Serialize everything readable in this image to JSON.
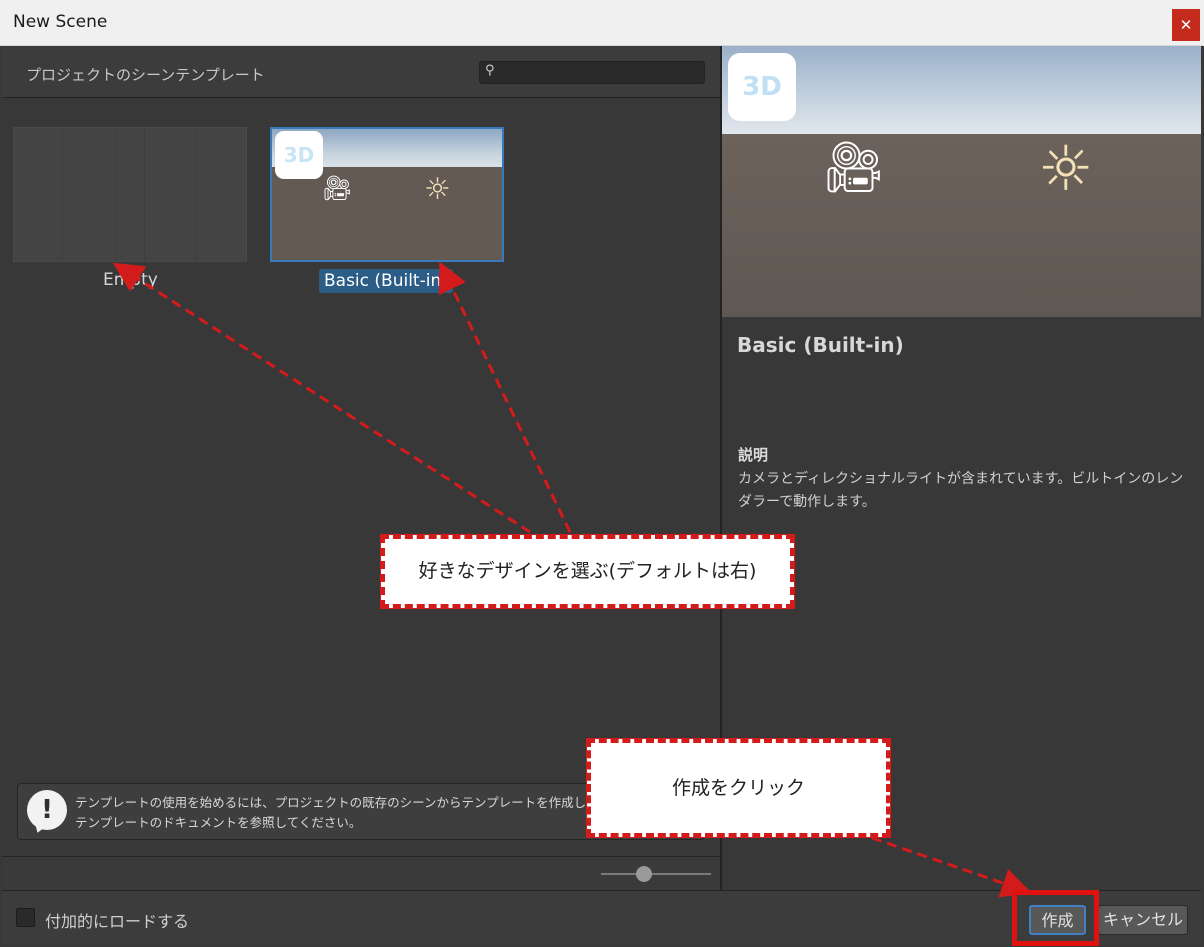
{
  "window": {
    "title": "New Scene",
    "close_glyph": "✕"
  },
  "left_panel": {
    "heading": "プロジェクトのシーンテンプレート",
    "search": {
      "icon": "search-icon",
      "value": "",
      "placeholder": ""
    },
    "templates": [
      {
        "label": "Empty",
        "selected": false
      },
      {
        "label": "Basic (Built-in)",
        "selected": true,
        "badge": "3D"
      }
    ],
    "help": {
      "icon": "exclamation-icon",
      "glyph": "!",
      "line1": "テンプレートの使用を始めるには、プロジェクトの既存のシーンからテンプレートを作成します。",
      "line2": "テンプレートのドキュメントを参照してください。"
    },
    "zoom_level": 0.37
  },
  "preview": {
    "badge": "3D",
    "title": "Basic (Built-in)",
    "description_label": "説明",
    "description": "カメラとディレクショナルライトが含まれています。ビルトインのレンダラーで動作します。"
  },
  "bottom": {
    "load_additively_label": "付加的にロードする",
    "load_additively_checked": false,
    "create_label": "作成",
    "cancel_label": "キャンセル"
  },
  "annotations": {
    "callout_select": "好きなデザインを選ぶ(デフォルトは右)",
    "callout_create": "作成をクリック",
    "color": "#d31b1b"
  },
  "colors": {
    "selection": "#2c5d87",
    "accent": "#3f82c4"
  }
}
